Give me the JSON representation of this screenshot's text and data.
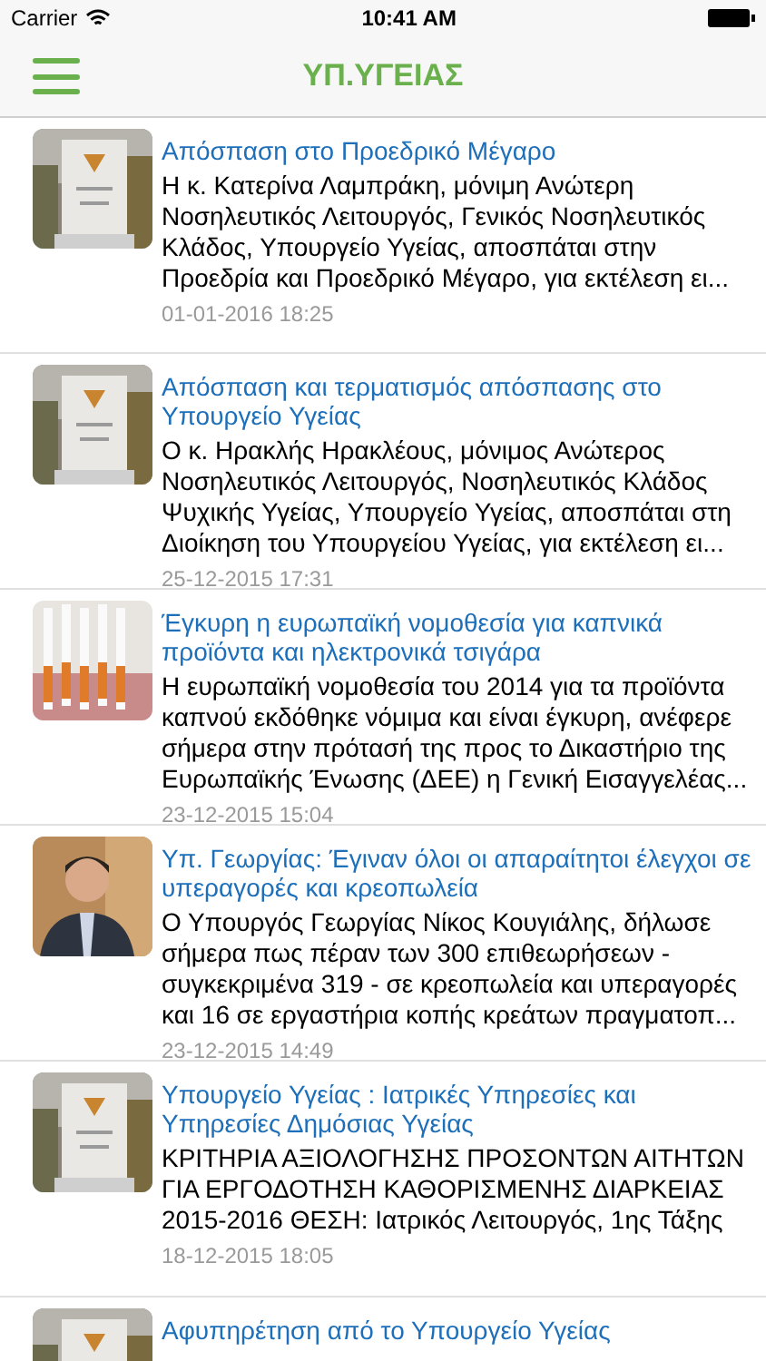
{
  "status_bar": {
    "carrier": "Carrier",
    "time": "10:41 AM"
  },
  "nav_bar": {
    "title": "ΥΠ.ΥΓΕΙΑΣ"
  },
  "articles": [
    {
      "title": "Απόσπαση στο Προεδρικό Μέγαρο",
      "summary": "Η κ. Κατερίνα Λαμπράκη, μόνιμη Ανώτερη Νοσηλευτικός Λειτουργός, Γενικός Νοσηλευτικός Κλάδος, Υπουργείο Υγείας, αποσπάται στην Προεδρία και Προεδρικό Μέγαρο, για εκτέλεση ει...",
      "date": "01-01-2016 18:25"
    },
    {
      "title": "Απόσπαση και τερματισμός απόσπασης στο Υπουργείο Υγείας",
      "summary": "Ο κ. Ηρακλής Ηρακλέους, μόνιμος Ανώτερος Νοσηλευτικός Λειτουργός, Νοσηλευτικός Κλάδος Ψυχικής Υγείας, Υπουργείο Υγείας, αποσπάται στη Διοίκηση του Υπουργείου Υγείας, για εκτέλεση ει...",
      "date": "25-12-2015 17:31"
    },
    {
      "title": "Έγκυρη η ευρωπαϊκή νομοθεσία για καπνικά προϊόντα και ηλεκτρονικά τσιγάρα",
      "summary": "Η ευρωπαϊκή νομοθεσία του 2014 για τα προϊόντα καπνού εκδόθηκε νόμιμα και είναι έγκυρη, ανέφερε σήμερα στην πρότασή της προς το Δικαστήριο της Ευρωπαϊκής Ένωσης (ΔΕΕ) η Γενική Εισαγγελέας...",
      "date": "23-12-2015 15:04"
    },
    {
      "title": "Υπ. Γεωργίας: Έγιναν όλοι οι απαραίτητοι έλεγχοι σε υπεραγορές και κρεοπωλεία",
      "summary": "Ο Υπουργός Γεωργίας Νίκος Κουγιάλης, δήλωσε σήμερα πως πέραν των 300 επιθεωρήσεων - συγκεκριμένα 319 - σε κρεοπωλεία και υπεραγορές και 16 σε εργαστήρια κοπής κρεάτων πραγματοπ...",
      "date": "23-12-2015 14:49"
    },
    {
      "title": "Υπουργείο Υγείας : Ιατρικές Υπηρεσίες και Υπηρεσίες Δημόσιας Υγείας",
      "summary": "ΚΡΙΤΗΡΙΑ ΑΞΙΟΛΟΓΗΣΗΣ ΠΡΟΣΟΝΤΩΝ ΑΙΤΗΤΩΝ ΓΙΑ ΕΡΓΟΔΟΤΗΣΗ ΚΑΘΟΡΙΣΜΕΝΗΣ ΔΙΑΡΚΕΙΑΣ 2015-2016 ΘΕΣΗ: Ιατρικός Λειτουργός, 1ης Τάξης",
      "date": "18-12-2015 18:05"
    },
    {
      "title": "Αφυπηρέτηση από το Υπουργείο Υγείας"
    }
  ]
}
